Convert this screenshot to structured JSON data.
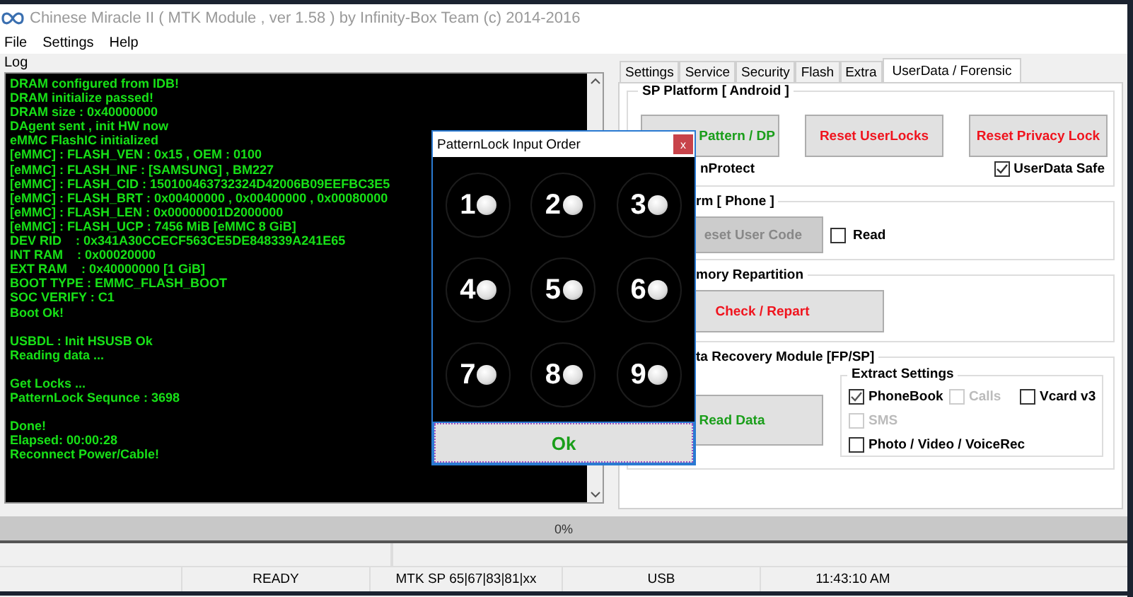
{
  "window": {
    "title": "Chinese Miracle II ( MTK Module , ver 1.58 ) by Infinity-Box Team (c) 2014-2016"
  },
  "menu": [
    "File",
    "Settings",
    "Help"
  ],
  "log": {
    "label": "Log",
    "blocks": [
      [
        "DRAM configured from IDB!",
        "DRAM initialize passed!",
        "DRAM size : 0x40000000",
        "DAgent sent , init HW now",
        "eMMC FlashIC initialized",
        "[eMMC] : FLASH_VEN : 0x15 , OEM : 0100",
        "[eMMC] : FLASH_INF : [SAMSUNG] , BM227",
        "[eMMC] : FLASH_CID : 150100463732324D42006B09EEFBC3E5",
        "[eMMC] : FLASH_BRT : 0x00400000 , 0x00400000 , 0x00080000",
        "[eMMC] : FLASH_LEN : 0x00000001D2000000",
        "[eMMC] : FLASH_UCP : 7456 MiB [eMMC 8 GiB]",
        "DEV RID    : 0x341A30CCECF563CE5DE848339A241E65",
        "INT RAM    : 0x00020000",
        "EXT RAM    : 0x40000000 [1 GiB]",
        "BOOT TYPE : EMMC_FLASH_BOOT",
        "SOC VERIFY : C1",
        "Boot Ok!"
      ],
      [
        "USBDL : Init HSUSB Ok",
        "Reading data ..."
      ],
      [
        "Get Locks ...",
        "PatternLock Sequnce : 3698"
      ],
      [
        "Done!",
        "Elapsed: 00:00:28",
        "Reconnect Power/Cable!"
      ]
    ]
  },
  "tabs": [
    {
      "label": "Settings",
      "selected": false
    },
    {
      "label": "Service",
      "selected": false
    },
    {
      "label": "Security",
      "selected": false
    },
    {
      "label": "Flash",
      "selected": false
    },
    {
      "label": "Extra",
      "selected": false
    },
    {
      "label": "UserData / Forensic",
      "selected": true
    }
  ],
  "groups": [
    {
      "title": "SP Platform [ Android ]",
      "buttons": [
        {
          "label": "Pattern / DP",
          "kind": "go"
        },
        {
          "label": "Reset UserLocks",
          "kind": "danger"
        },
        {
          "label": "Reset Privacy Lock",
          "kind": "danger"
        }
      ],
      "note": "nProtect",
      "checkbox": {
        "label": "UserData Safe",
        "checked": true
      }
    },
    {
      "title": "rm [ Phone ]",
      "buttons": [
        {
          "label": "eset User Code",
          "kind": "disabled"
        }
      ],
      "checkbox": {
        "label": "Read",
        "checked": false
      }
    },
    {
      "title": "mory Repartition",
      "buttons": [
        {
          "label": "Check / Repart",
          "kind": "danger"
        }
      ]
    },
    {
      "title": "ta Recovery Module  [FP/SP]",
      "buttons": [
        {
          "label": "Read Data",
          "kind": "go"
        }
      ],
      "extract": {
        "title": "Extract Settings",
        "options": [
          {
            "label": "PhoneBook",
            "checked": true,
            "disabled": false
          },
          {
            "label": "Calls",
            "checked": false,
            "disabled": true
          },
          {
            "label": "Vcard v3",
            "checked": false,
            "disabled": false
          },
          {
            "label": "SMS",
            "checked": false,
            "disabled": true
          },
          {
            "label": "Photo / Video / VoiceRec",
            "checked": false,
            "disabled": false
          }
        ]
      }
    }
  ],
  "dialog": {
    "title": "PatternLock Input Order",
    "close": "x",
    "dots": [
      "1",
      "2",
      "3",
      "4",
      "5",
      "6",
      "7",
      "8",
      "9"
    ],
    "ok": "Ok"
  },
  "progress": {
    "text": "0%",
    "level": 0
  },
  "status_bar": [
    "READY",
    "MTK SP 65|67|83|81|xx",
    "USB",
    "11:43:10 AM"
  ]
}
